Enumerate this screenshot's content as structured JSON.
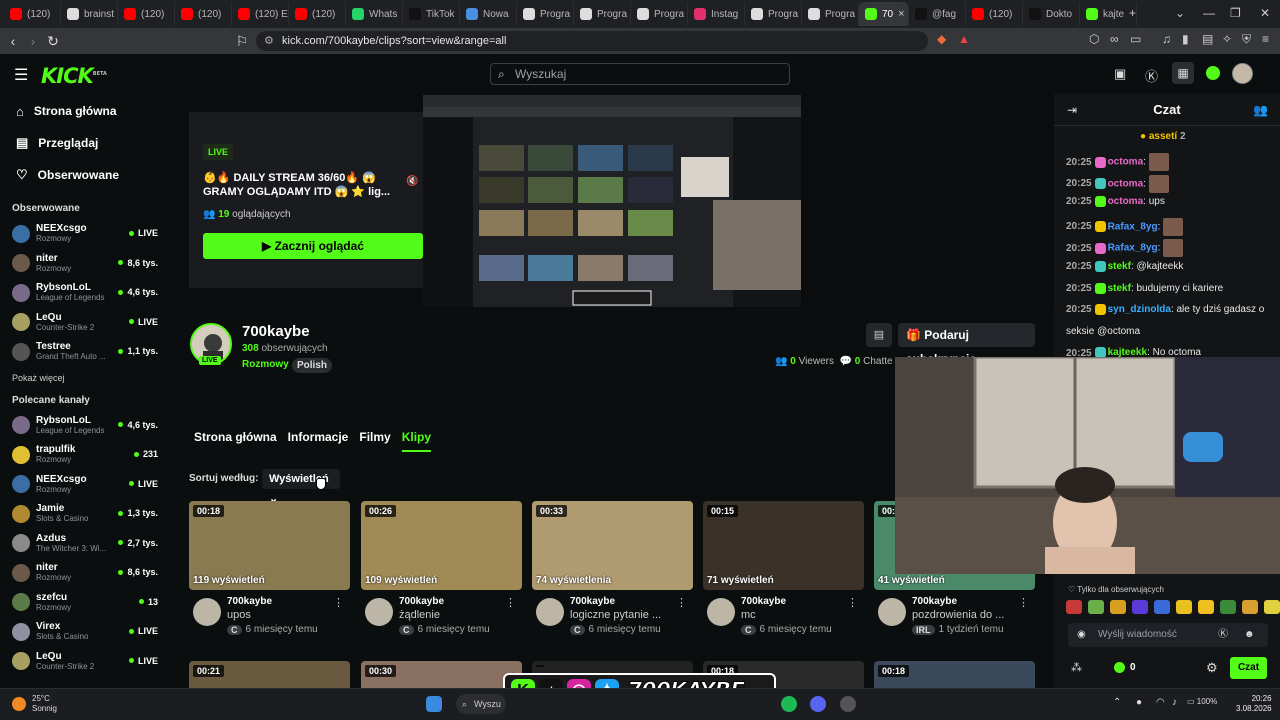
{
  "browser": {
    "tabs": [
      {
        "label": "(120)",
        "color": "#ff0000"
      },
      {
        "label": "brainst",
        "color": "#dddddd"
      },
      {
        "label": "(120) ",
        "color": "#ff0000"
      },
      {
        "label": "(120) ",
        "color": "#ff0000"
      },
      {
        "label": "(120) E",
        "color": "#ff0000"
      },
      {
        "label": "(120) ",
        "color": "#ff0000"
      },
      {
        "label": "Whats",
        "color": "#25d366"
      },
      {
        "label": "TikTok",
        "color": "#111111"
      },
      {
        "label": "Nowa",
        "color": "#4a90e2"
      },
      {
        "label": "Progra",
        "color": "#dddddd"
      },
      {
        "label": "Progra",
        "color": "#dddddd"
      },
      {
        "label": "Progra",
        "color": "#dddddd"
      },
      {
        "label": "Instag",
        "color": "#e1306c"
      },
      {
        "label": "Progra",
        "color": "#dddddd"
      },
      {
        "label": "Progra",
        "color": "#dddddd"
      },
      {
        "label": "70",
        "color": "#53fc18",
        "active": true
      },
      {
        "label": "@fag",
        "color": "#111111"
      },
      {
        "label": "(120) ",
        "color": "#ff0000"
      },
      {
        "label": "Dokto",
        "color": "#111111"
      },
      {
        "label": "kajte",
        "color": "#53fc18"
      }
    ],
    "url": "kick.com/700kaybe/clips?sort=view&range=all"
  },
  "header": {
    "logo": "KICK",
    "logo_badge": "BETA",
    "search_placeholder": "Wyszukaj"
  },
  "sidebar": {
    "nav": [
      {
        "label": "Strona główna",
        "icon": "home-icon"
      },
      {
        "label": "Przeglądaj",
        "icon": "browse-icon"
      },
      {
        "label": "Obserwowane",
        "icon": "heart-icon"
      }
    ],
    "followed_title": "Obserwowane",
    "followed": [
      {
        "name": "NEEXcsgo",
        "game": "Rozmowy",
        "status": "LIVE",
        "live": true,
        "color": "#3a6ea5"
      },
      {
        "name": "niter",
        "game": "Rozmowy",
        "status": "8,6 tys.",
        "live": false,
        "color": "#6b5a4a"
      },
      {
        "name": "RybsonLoL",
        "game": "League of Legends",
        "status": "4,6 tys.",
        "live": false,
        "color": "#7a6a8a"
      },
      {
        "name": "LeQu",
        "game": "Counter-Strike 2",
        "status": "LIVE",
        "live": true,
        "color": "#a8a060"
      },
      {
        "name": "Testree",
        "game": "Grand Theft Auto ...",
        "status": "1,1 tys.",
        "live": false,
        "color": "#555555"
      }
    ],
    "show_more": "Pokaż więcej",
    "recommended_title": "Polecane kanały",
    "recommended": [
      {
        "name": "RybsonLoL",
        "game": "League of Legends",
        "status": "4,6 tys.",
        "live": false,
        "color": "#7a6a8a"
      },
      {
        "name": "trapulfik",
        "game": "Rozmowy",
        "status": "231",
        "live": false,
        "color": "#e0c030"
      },
      {
        "name": "NEEXcsgo",
        "game": "Rozmowy",
        "status": "LIVE",
        "live": true,
        "color": "#3a6ea5"
      },
      {
        "name": "Jamie",
        "game": "Slots & Casino",
        "status": "1,3 tys.",
        "live": false,
        "color": "#b08a30"
      },
      {
        "name": "Azdus",
        "game": "The Witcher 3: Wi...",
        "status": "2,7 tys.",
        "live": false,
        "color": "#8a8a8a"
      },
      {
        "name": "niter",
        "game": "Rozmowy",
        "status": "8,6 tys.",
        "live": false,
        "color": "#6b5a4a"
      },
      {
        "name": "szefcu",
        "game": "Rozmowy",
        "status": "13",
        "live": false,
        "color": "#5a7a4a"
      },
      {
        "name": "Virex",
        "game": "Slots & Casino",
        "status": "LIVE",
        "live": true,
        "color": "#9090a0"
      },
      {
        "name": "LeQu",
        "game": "Counter-Strike 2",
        "status": "LIVE",
        "live": true,
        "color": "#a8a060"
      }
    ]
  },
  "offline_card": {
    "live_badge": "LIVE",
    "title": "👶🔥 DAILY STREAM 36/60🔥 😱 GRAMY OGLĄDAMY ITD 😱 ⭐ lig...",
    "viewers_count": "19",
    "viewers_label": "oglądających",
    "watch_button": "Zacznij oglądać"
  },
  "channel": {
    "name": "700kaybe",
    "followers_count": "308",
    "followers_label": "obserwujących",
    "category": "Rozmowy",
    "language": "Polish",
    "live_badge": "LIVE",
    "sub_button": "Podaruj subskrypcje",
    "viewers_count": "0",
    "viewers_label": "Viewers",
    "chatters_count": "0",
    "chatters_label": "Chatte"
  },
  "channel_tabs": [
    "Strona główna",
    "Informacje",
    "Filmy",
    "Klipy"
  ],
  "active_tab": "Klipy",
  "sort": {
    "label": "Sortuj według:",
    "value": "Wyświetleń"
  },
  "clips": [
    {
      "duration": "00:18",
      "views": "119 wyświetleń",
      "author": "700kaybe",
      "title": "upos",
      "badge": "C",
      "age": "6 miesięcy temu",
      "bg": "#8a7a50"
    },
    {
      "duration": "00:26",
      "views": "109 wyświetleń",
      "author": "700kaybe",
      "title": "żądlenie",
      "badge": "C",
      "age": "6 miesięcy temu",
      "bg": "#a08a55"
    },
    {
      "duration": "00:33",
      "views": "74 wyświetlenia",
      "author": "700kaybe",
      "title": "logiczne pytanie ...",
      "badge": "C",
      "age": "6 miesięcy temu",
      "bg": "#b09a70"
    },
    {
      "duration": "00:15",
      "views": "71 wyświetleń",
      "author": "700kaybe",
      "title": "mc",
      "badge": "C",
      "age": "6 miesięcy temu",
      "bg": "#3a3228"
    },
    {
      "duration": "00:",
      "views": "41 wyświetleń",
      "author": "700kaybe",
      "title": "pozdrowienia do ...",
      "badge": "IRL",
      "age": "1 tydzień temu",
      "bg": "#4a8a6a"
    }
  ],
  "clips_row2": [
    {
      "duration": "00:21",
      "bg": "#6a5a40"
    },
    {
      "duration": "00:30",
      "bg": "#8a7060"
    },
    {
      "duration": "",
      "bg": "#222222"
    },
    {
      "duration": "00:18",
      "bg": "#2a2a2a"
    },
    {
      "duration": "00:18",
      "bg": "#3a4a5a"
    }
  ],
  "chat": {
    "title": "Czat",
    "pinned_user": "assetí",
    "pinned_count": "2",
    "messages": [
      {
        "time": "20:25",
        "user": "octoma",
        "text": "",
        "ucolor": "#e86ac8",
        "emote": true
      },
      {
        "time": "20:25",
        "user": "octoma",
        "text": "",
        "ucolor": "#e86ac8",
        "emote": true
      },
      {
        "time": "20:25",
        "user": "octoma",
        "text": "ups",
        "ucolor": "#e86ac8",
        "emote": false
      },
      {
        "time": "20:25",
        "user": "Rafax_8yg",
        "text": "",
        "ucolor": "#4a9aff",
        "emote": true
      },
      {
        "time": "20:25",
        "user": "Rafax_8yg",
        "text": "",
        "ucolor": "#4a9aff",
        "emote": true
      },
      {
        "time": "20:25",
        "user": "stekf",
        "text": "@kajteekk",
        "ucolor": "#53fc18",
        "emote": false
      },
      {
        "time": "20:25",
        "user": "stekf",
        "text": "budujemy ci kariere",
        "ucolor": "#53fc18",
        "emote": false
      },
      {
        "time": "20:25",
        "user": "syn_dzinolda",
        "text": "ale ty dziś gadasz o",
        "ucolor": "#3ab0ff",
        "emote": false
      },
      {
        "time": "",
        "user": "",
        "text": "seksie @octoma",
        "ucolor": "#3ab0ff",
        "emote": false
      },
      {
        "time": "20:25",
        "user": "kajteekk",
        "text": "No octoma",
        "ucolor": "#53fc18",
        "emote": false
      }
    ],
    "followers_only": "Tylko dla obserwujących",
    "input_placeholder": "Wyślij wiadomość",
    "points": "0",
    "send_button": "Czat"
  },
  "overlay": {
    "text": "700KAYBE"
  },
  "taskbar": {
    "temp": "25°C",
    "weather": "Sonnig",
    "search": "Wyszu",
    "battery": "100%",
    "time": "20:26",
    "date": "3.08.2026"
  }
}
